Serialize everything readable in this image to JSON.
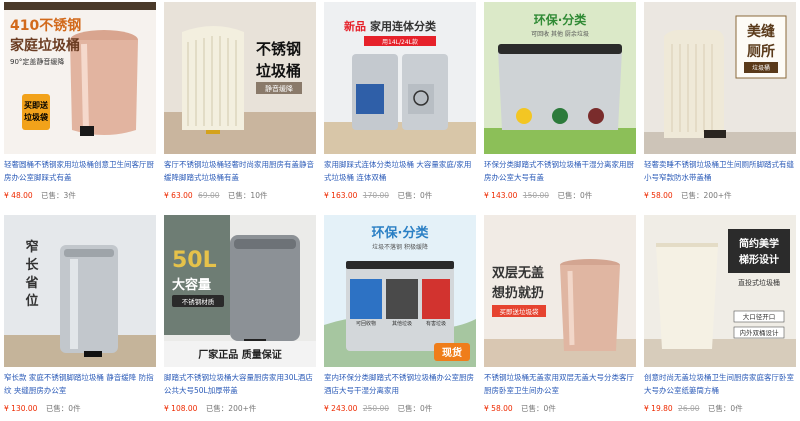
{
  "products": [
    {
      "title": "轻奢圆桶不锈钢家用垃圾桶创意卫生间客厅厨房办公室脚踩式有盖",
      "currency": "¥",
      "price": "48.00",
      "original": "",
      "sold": "已售：3件",
      "overlay": {
        "line1": "410不锈钢",
        "line2": "家庭垃圾桶",
        "line3": "90°定盖静音缓降",
        "badge1": "买即送",
        "badge2": "垃圾袋"
      }
    },
    {
      "title": "客厅不锈钢垃圾桶轻奢时尚家用厨房有盖静音缓降脚踏式垃圾桶有盖",
      "currency": "¥",
      "price": "63.00",
      "original": "69.00",
      "sold": "已售：10件",
      "overlay": {
        "line1": "不锈钢",
        "line2": "垃圾桶",
        "line3": "静音缓降"
      }
    },
    {
      "title": "家用脚踩式连体分类垃圾桶 大容量家庭/家用式垃圾桶 连体双桶",
      "currency": "¥",
      "price": "163.00",
      "original": "170.00",
      "sold": "已售：0件",
      "overlay": {
        "line1a": "新品",
        "line1b": "家用连体分类",
        "line2": "用14L/24L款"
      }
    },
    {
      "title": "环保分类脚踏式不锈钢垃圾桶干湿分离家用厨房办公室大号有盖",
      "currency": "¥",
      "price": "143.00",
      "original": "150.00",
      "sold": "已售：0件",
      "overlay": {
        "line1": "环保·分类",
        "line2": "可回收 其他 厨余垃圾"
      }
    },
    {
      "title": "轻奢卖睡不锈钢垃圾桶卫生间厕所脚踏式有缝小号窄款防水带盖桶",
      "currency": "¥",
      "price": "58.00",
      "original": "",
      "sold": "已售：200+件",
      "overlay": {
        "line1": "美缝",
        "line2": "厕所",
        "line3": "垃圾桶"
      }
    },
    {
      "title": "窄长款 家庭不锈钢脚踏垃圾桶 静音缓降 防指纹 夹缝厨房办公室",
      "currency": "¥",
      "price": "130.00",
      "original": "",
      "sold": "已售：0件",
      "overlay": {
        "line1": "窄",
        "line2": "长",
        "line3": "省",
        "line4": "位"
      }
    },
    {
      "title": "脚踏式不锈钢垃圾桶大容量厨房家用30L酒店公共大号50L加厚带盖",
      "currency": "¥",
      "price": "108.00",
      "original": "",
      "sold": "已售：200+件",
      "overlay": {
        "line1": "50L",
        "line2": "大容量",
        "line3": "不锈钢材质",
        "line4": "厂家正品 质量保证"
      }
    },
    {
      "title": "室内环保分类脚踏式不锈钢垃圾桶办公室厨房酒店大号干湿分离家用",
      "currency": "¥",
      "price": "243.00",
      "original": "250.00",
      "sold": "已售：0件",
      "overlay": {
        "line1": "环保·分类",
        "line2": "垃圾不落钢 积极缓降",
        "line3": "可回收物",
        "line4": "其他垃圾",
        "line5": "有害垃圾",
        "badge": "现货"
      }
    },
    {
      "title": "不锈钢垃圾桶无盖家用双层无盖大号分类客厅厨房卧室卫生间办公室",
      "currency": "¥",
      "price": "58.00",
      "original": "",
      "sold": "已售：0件",
      "overlay": {
        "line1": "双层无盖",
        "line2": "想扔就扔",
        "badge": "买即送垃圾袋"
      }
    },
    {
      "title": "创意时尚无盖垃圾桶卫生间厨房家庭客厅卧室大号办公室纸篓筒方桶",
      "currency": "¥",
      "price": "19.80",
      "original": "26.00",
      "sold": "已售：0件",
      "overlay": {
        "line1": "简约美学",
        "line2": "梯形设计",
        "line3": "直投式垃圾桶",
        "line4": "大口径开口",
        "line5": "内外双桶设计"
      }
    }
  ],
  "colors": {
    "link": "#2d5cb8",
    "price": "#ee2a00",
    "muted": "#aaaaaa"
  }
}
